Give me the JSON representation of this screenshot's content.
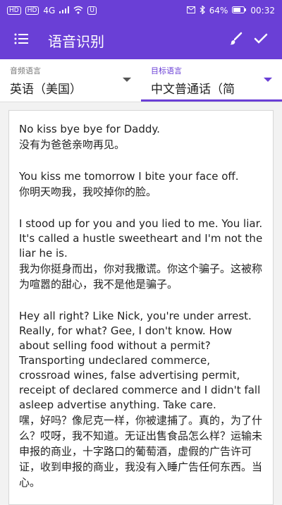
{
  "status": {
    "left_chips": [
      "HD",
      "HD"
    ],
    "signal_text": "4G",
    "badge": "U",
    "battery": "64%",
    "time": "00:32"
  },
  "appbar": {
    "title": "语音识别",
    "menu_icon": "menu-icon",
    "brush_icon": "brush-icon",
    "check_icon": "check-icon"
  },
  "languages": {
    "source_label": "音频语言",
    "source_value": "英语（美国）",
    "target_label": "目标语言",
    "target_value": "中文普通话（简"
  },
  "transcript": [
    {
      "en": "No kiss bye bye for Daddy.",
      "zh": "没有为爸爸亲吻再见。"
    },
    {
      "en": "You kiss me tomorrow I bite your face off.",
      "zh": "你明天吻我，我咬掉你的脸。"
    },
    {
      "en": "I stood up for you and you lied to me. You liar. It's called a hustle sweetheart and I'm not the liar he is.",
      "zh": "我为你挺身而出，你对我撒谎。你这个骗子。这被称为喧嚣的甜心，我不是他是骗子。"
    },
    {
      "en": "Hey all right? Like Nick, you're under arrest. Really, for what? Gee, I don't know. How about selling food without a permit? Transporting undeclared commerce, crossroad wines, false advertising permit, receipt of declared commerce and I didn't fall asleep advertise anything. Take care.",
      "zh": "嘿，好吗？像尼克一样，你被逮捕了。真的，为了什么？哎呀，我不知道。无证出售食品怎么样？运输未申报的商业，十字路口的葡萄酒，虚假的广告许可证，收到申报的商业，我没有入睡广告任何东西。当心。"
    }
  ],
  "colors": {
    "primary": "#6a3fd6",
    "background": "#f2f2f2"
  }
}
